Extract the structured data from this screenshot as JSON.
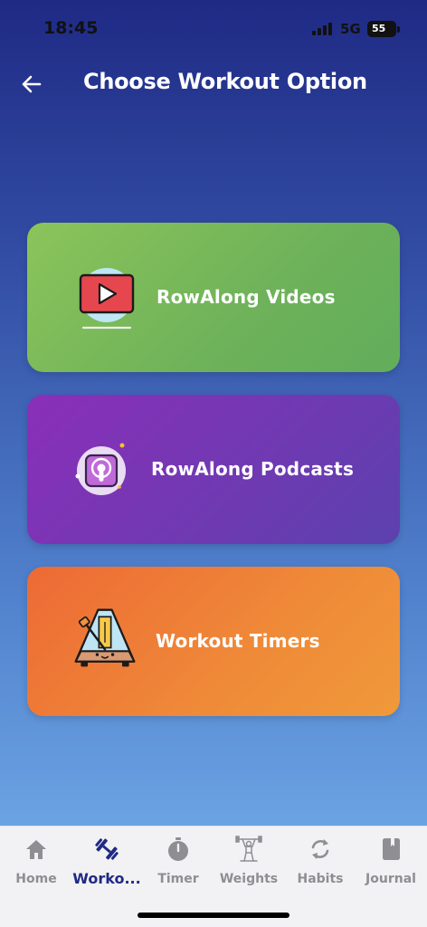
{
  "status_bar": {
    "time": "18:45",
    "network": "5G",
    "battery": "55"
  },
  "header": {
    "back_icon": "arrow-left-icon",
    "title": "Choose Workout Option"
  },
  "options": [
    {
      "label": "RowAlong Videos",
      "icon": "video-play-icon",
      "color": "#6eb25a"
    },
    {
      "label": "RowAlong Podcasts",
      "icon": "podcast-icon",
      "color": "#7236b4"
    },
    {
      "label": "Workout Timers",
      "icon": "metronome-icon",
      "color": "#ef8a38"
    }
  ],
  "tab_bar": {
    "active": "Worko...",
    "tabs": [
      {
        "label": "Home",
        "icon": "home-icon"
      },
      {
        "label": "Worko...",
        "icon": "dumbbell-icon"
      },
      {
        "label": "Timer",
        "icon": "stopwatch-icon"
      },
      {
        "label": "Weights",
        "icon": "weightlifter-icon"
      },
      {
        "label": "Habits",
        "icon": "refresh-icon"
      },
      {
        "label": "Journal",
        "icon": "journal-icon"
      }
    ]
  },
  "colors": {
    "accent": "#1f2a85",
    "tab_inactive": "#8e8e93"
  }
}
